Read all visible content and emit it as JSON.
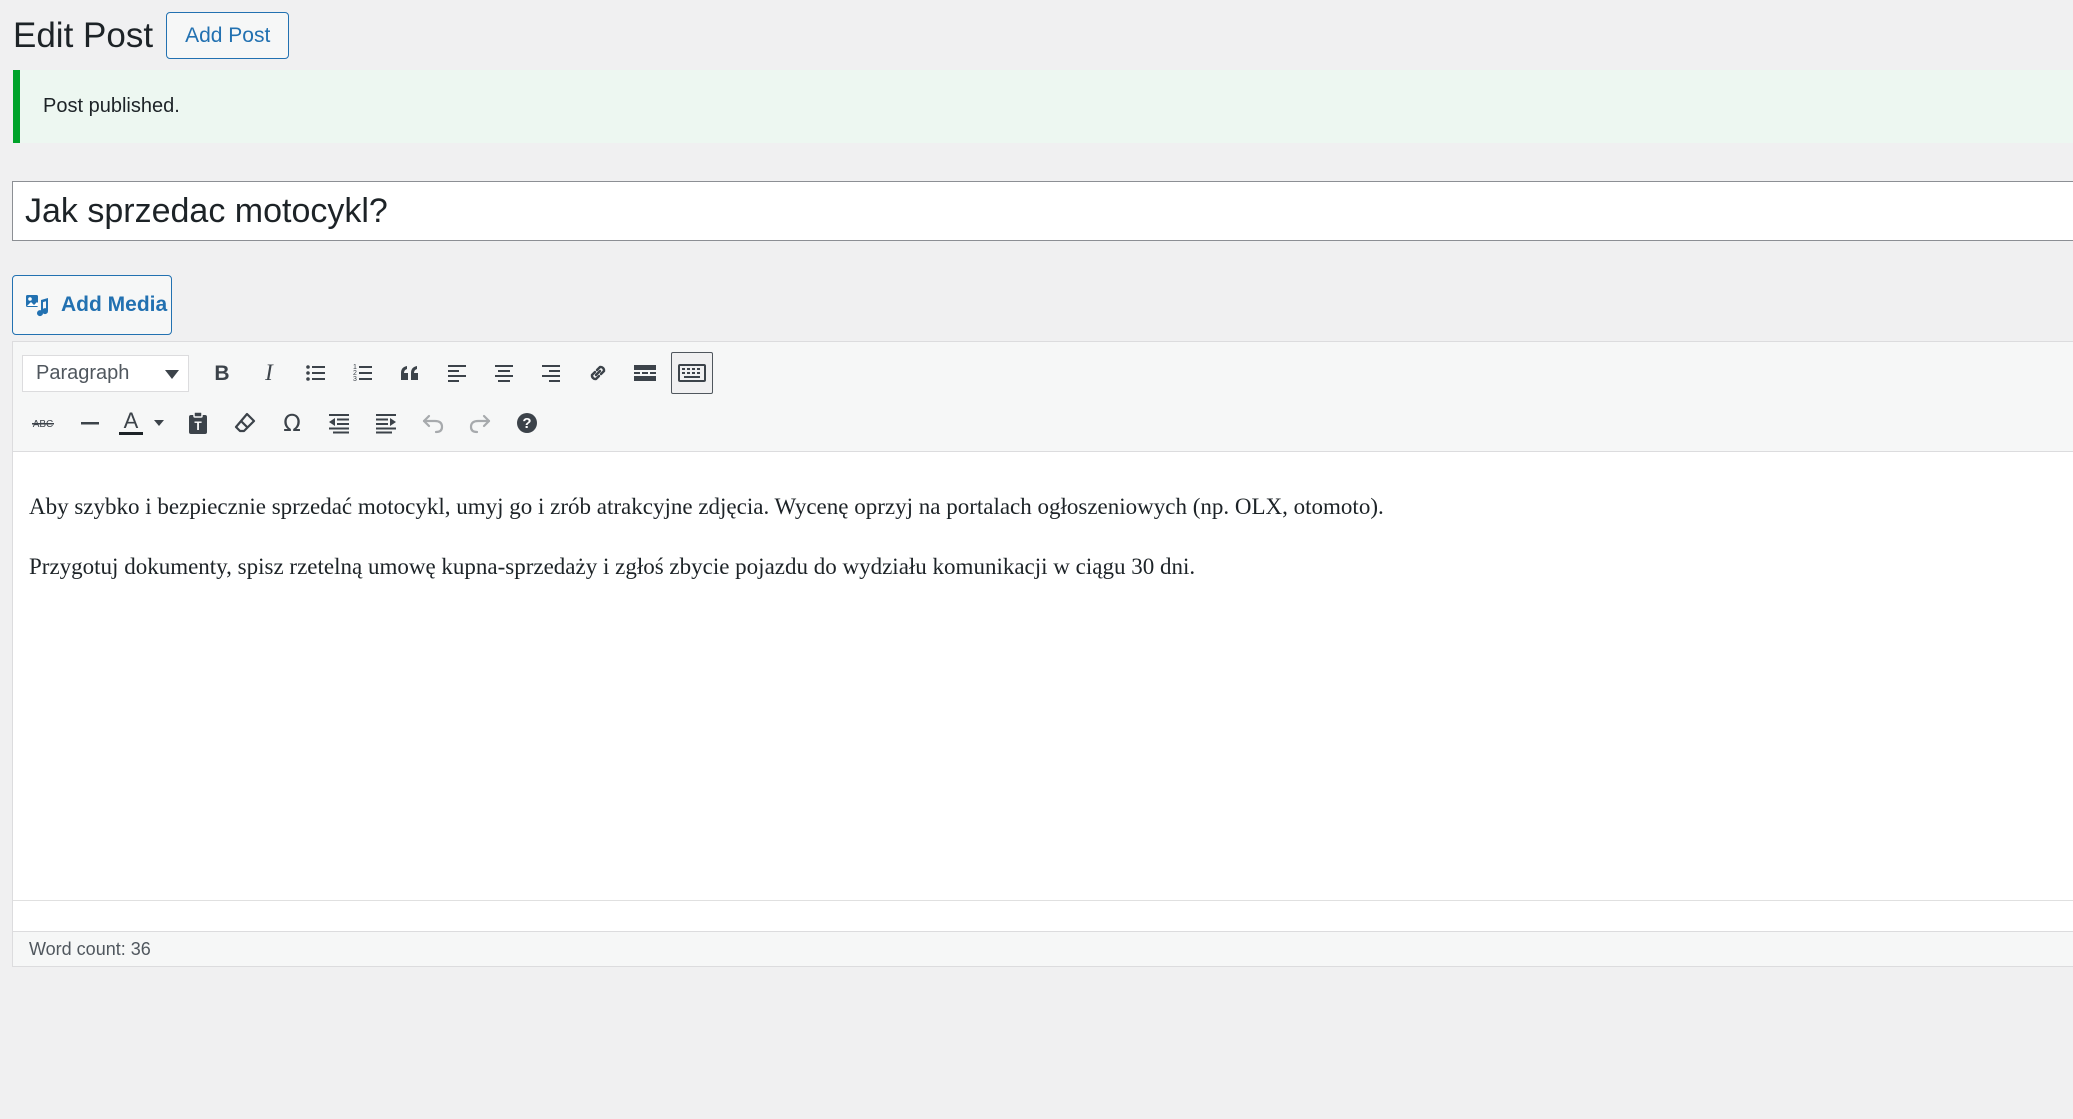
{
  "header": {
    "title": "Edit Post",
    "add_post_label": "Add Post"
  },
  "notice": {
    "text": "Post published."
  },
  "post": {
    "title": "Jak sprzedac motocykl?"
  },
  "media": {
    "add_media_label": "Add Media"
  },
  "toolbar": {
    "format_selected": "Paragraph",
    "row1_buttons": [
      "bold-icon",
      "italic-icon",
      "bulleted-list-icon",
      "numbered-list-icon",
      "blockquote-icon",
      "align-left-icon",
      "align-center-icon",
      "align-right-icon",
      "link-icon",
      "read-more-icon",
      "toolbar-toggle-icon"
    ],
    "row2_buttons": [
      "strikethrough-icon",
      "horizontal-line-icon",
      "text-color-icon",
      "paste-as-text-icon",
      "clear-formatting-icon",
      "special-character-icon",
      "outdent-icon",
      "indent-icon",
      "undo-icon",
      "redo-icon",
      "help-icon"
    ],
    "strikethrough_glyph": "ABC",
    "text_color_glyph": "A",
    "special_char_glyph": "Ω",
    "help_glyph": "?"
  },
  "content": {
    "paragraphs": [
      "Aby szybko i bezpiecznie sprzedać motocykl, umyj go i zrób atrakcyjne zdjęcia. Wycenę oprzyj na portalach ogłoszeniowych (np. OLX, otomoto).",
      "Przygotuj dokumenty, spisz rzetelną umowę kupna-sprzedaży i zgłoś zbycie pojazdu do wydziału komunikacji w ciągu 30 dni."
    ]
  },
  "status": {
    "word_count": "Word count: 36"
  },
  "colors": {
    "accent": "#2271b1",
    "success": "#00a32a",
    "background": "#f0f0f1"
  }
}
